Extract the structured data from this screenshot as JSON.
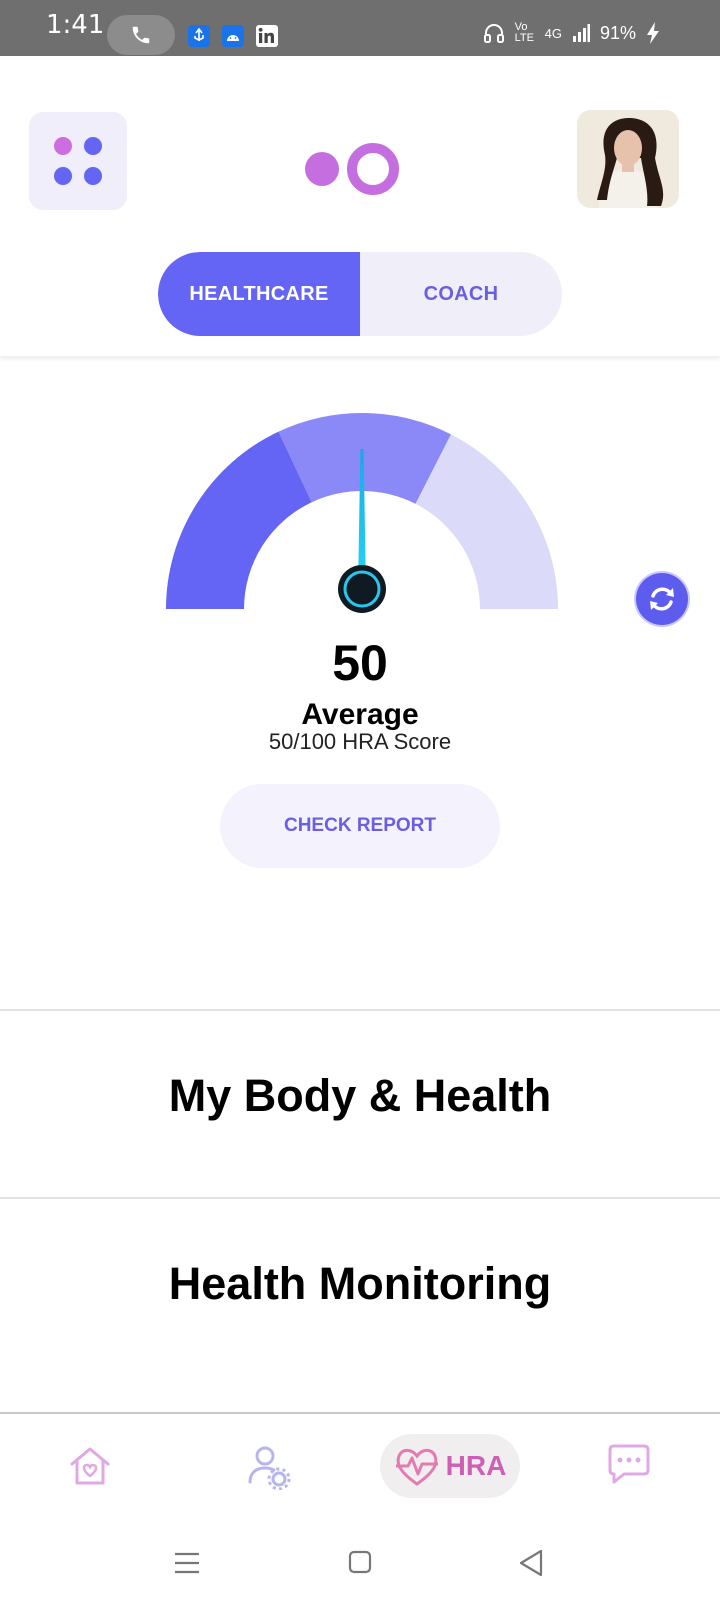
{
  "status_bar": {
    "time": "1:41",
    "network": "4G",
    "volte": "Vo LTE",
    "battery": "91%"
  },
  "header": {
    "menu_icon": "grid-dots-icon",
    "avatar": "user-avatar",
    "tabs": [
      {
        "label": "HEALTHCARE",
        "active": true
      },
      {
        "label": "COACH",
        "active": false
      }
    ]
  },
  "score": {
    "value": "50",
    "level": "Average",
    "subtitle": "50/100 HRA Score",
    "max": 100,
    "check_report_label": "CHECK REPORT"
  },
  "sections": [
    {
      "title": "My Body & Health"
    },
    {
      "title": "Health Monitoring"
    }
  ],
  "bottom_nav": {
    "items": [
      {
        "icon": "home-heart-icon"
      },
      {
        "icon": "user-settings-icon"
      },
      {
        "icon": "heartbeat-icon",
        "label": "HRA",
        "active": true
      },
      {
        "icon": "chat-bubble-icon"
      }
    ]
  },
  "colors": {
    "accent": "#6464f5",
    "gauge_low": "#6464f5",
    "gauge_mid": "#8b89f7",
    "gauge_high": "#dcdaf9",
    "pink": "#cd5fb6"
  }
}
